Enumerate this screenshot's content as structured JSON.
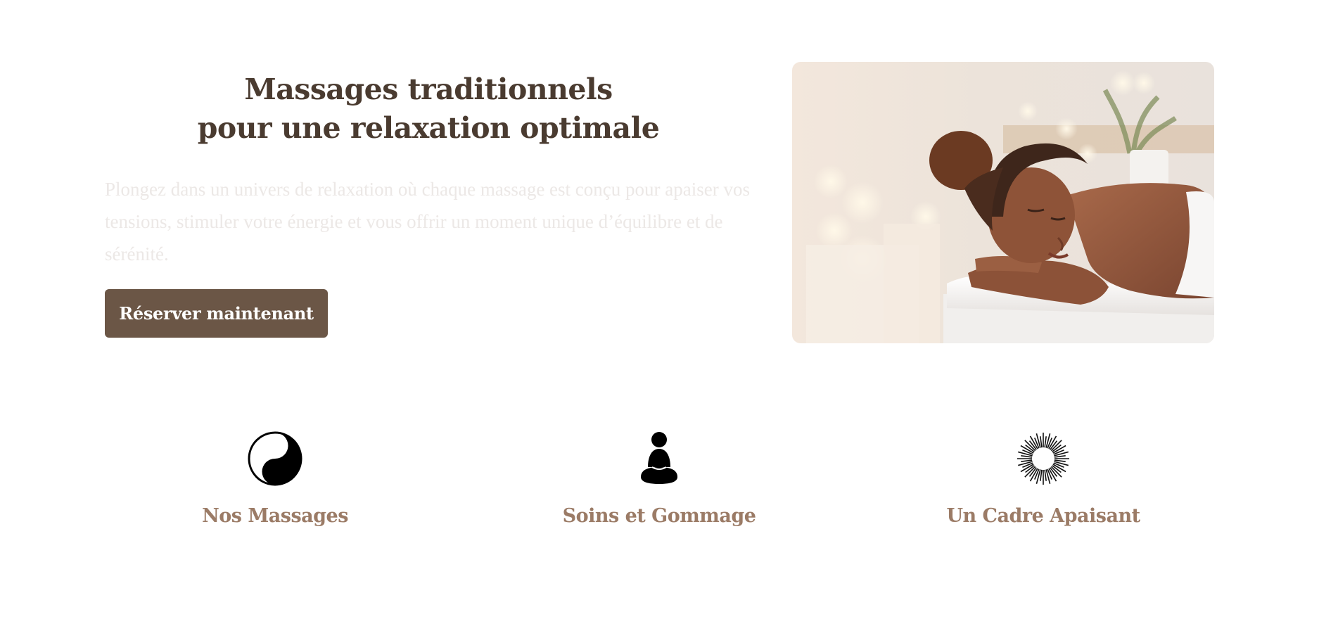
{
  "hero": {
    "title_line1": "Massages traditionnels",
    "title_line2": "pour une relaxation optimale",
    "description": "Plongez dans un univers de relaxation où chaque massage est conçu pour apaiser vos tensions, stimuler votre énergie et vous offrir un moment unique d’équilibre et de sérénité.",
    "cta_label": "Réserver maintenant"
  },
  "features": [
    {
      "icon": "yin-yang-icon",
      "label": "Nos Massages"
    },
    {
      "icon": "meditation-icon",
      "label": "Soins et Gommage"
    },
    {
      "icon": "sunburst-icon",
      "label": "Un Cadre Apaisant"
    }
  ],
  "colors": {
    "title": "#4a3b30",
    "button": "#6b5646",
    "feature_label": "#9b7b66",
    "description": "#ece8e6"
  }
}
